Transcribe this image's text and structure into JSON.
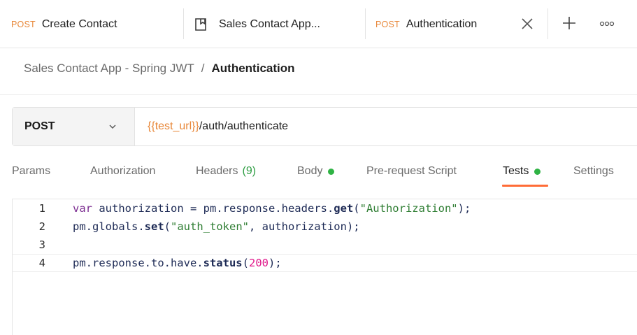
{
  "tabs": [
    {
      "method": "POST",
      "label": "Create Contact"
    },
    {
      "method": "",
      "label": "Sales Contact App..."
    },
    {
      "method": "POST",
      "label": "Authentication"
    }
  ],
  "breadcrumb": {
    "collection": "Sales Contact App - Spring JWT",
    "separator": "/",
    "current": "Authentication"
  },
  "request": {
    "method": "POST",
    "url_variable": "{{test_url}}",
    "url_path": "/auth/authenticate"
  },
  "request_tabs": [
    {
      "label": "Params"
    },
    {
      "label": "Authorization"
    },
    {
      "label": "Headers",
      "count": "(9)"
    },
    {
      "label": "Body",
      "has_dot": true
    },
    {
      "label": "Pre-request Script"
    },
    {
      "label": "Tests",
      "has_dot": true,
      "active": true
    },
    {
      "label": "Settings"
    }
  ],
  "editor": {
    "line_numbers": [
      "1",
      "2",
      "3",
      "4"
    ],
    "line1": {
      "kw": "var",
      "rest1": " authorization = pm.response.headers.",
      "fn": "get",
      "open": "(",
      "str": "\"Authorization\"",
      "close": ");"
    },
    "line2": {
      "pre": "pm.globals.",
      "fn": "set",
      "open": "(",
      "str": "\"auth_token\"",
      "close": ", authorization);"
    },
    "line4": {
      "pre": "pm.response.to.have.",
      "fn": "status",
      "open": "(",
      "num": "200",
      "close": ");"
    }
  },
  "colors": {
    "method_accent": "#e8883a",
    "active_tab_underline": "#ff6c37",
    "status_dot": "#2fb344",
    "string": "#2e7d32",
    "number": "#e0178a",
    "keyword": "#7a2a8f"
  },
  "icons": [
    "document-icon",
    "close-icon",
    "plus-icon",
    "more-icon",
    "chevron-down-icon"
  ]
}
